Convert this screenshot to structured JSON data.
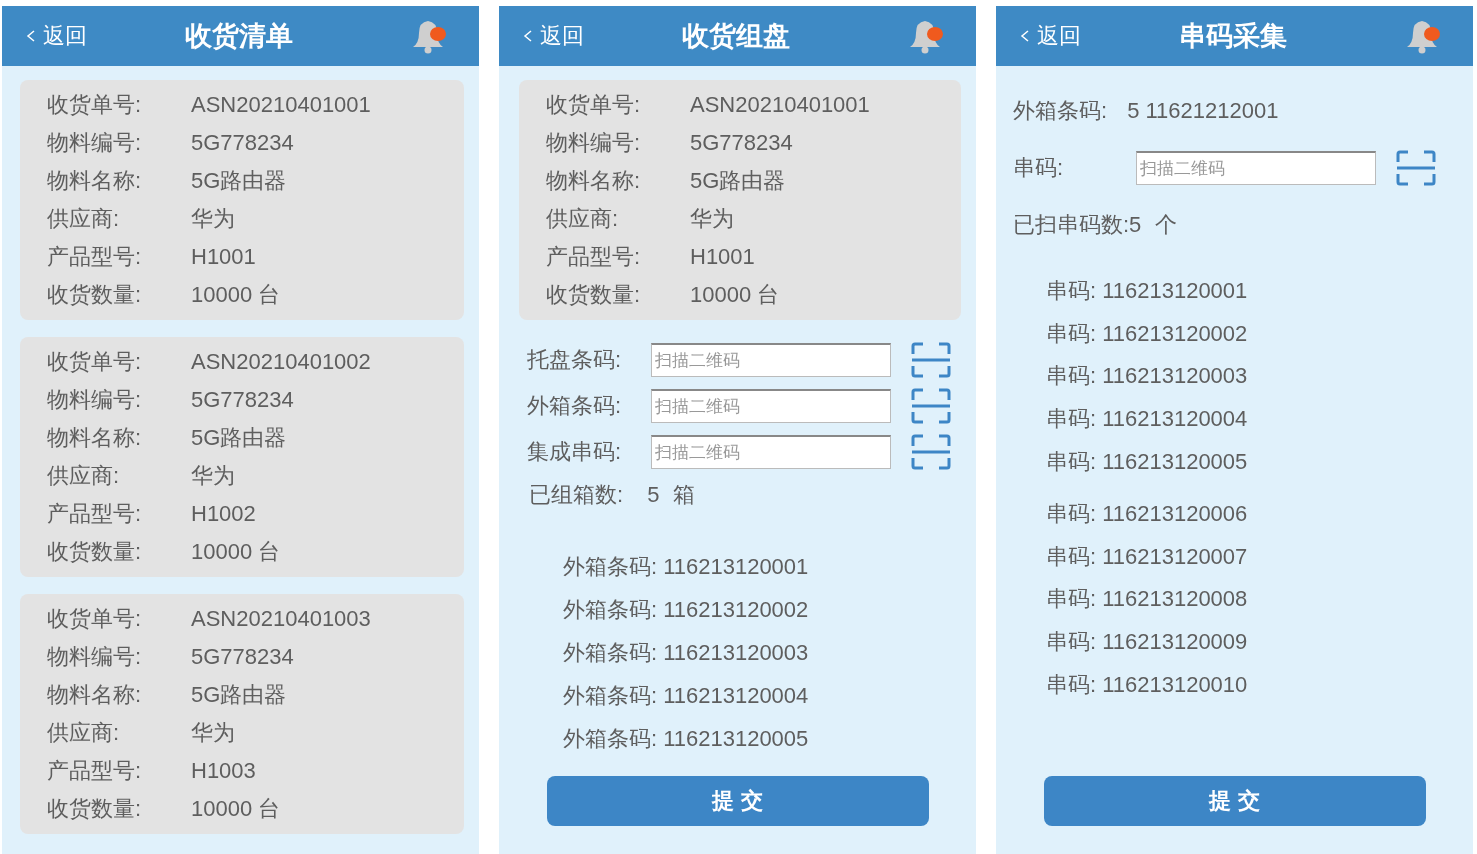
{
  "screens": [
    {
      "back": "返回",
      "title": "收货清单",
      "sections": [
        {
          "kind": "card",
          "fields": [
            {
              "label": "收货单号:",
              "value": "ASN20210401001"
            },
            {
              "label": "物料编号:",
              "value": "5G778234"
            },
            {
              "label": "物料名称:",
              "value": "5G路由器"
            },
            {
              "label": "供应商:",
              "value": "华为"
            },
            {
              "label": "产品型号:",
              "value": "H1001"
            },
            {
              "label": "收货数量:",
              "value": "10000 台"
            }
          ]
        },
        {
          "kind": "card",
          "fields": [
            {
              "label": "收货单号:",
              "value": "ASN20210401002"
            },
            {
              "label": "物料编号:",
              "value": "5G778234"
            },
            {
              "label": "物料名称:",
              "value": "5G路由器"
            },
            {
              "label": "供应商:",
              "value": "华为"
            },
            {
              "label": "产品型号:",
              "value": "H1002"
            },
            {
              "label": "收货数量:",
              "value": "10000 台"
            }
          ]
        },
        {
          "kind": "card",
          "fields": [
            {
              "label": "收货单号:",
              "value": "ASN20210401003"
            },
            {
              "label": "物料编号:",
              "value": "5G778234"
            },
            {
              "label": "物料名称:",
              "value": "5G路由器"
            },
            {
              "label": "供应商:",
              "value": "华为"
            },
            {
              "label": "产品型号:",
              "value": "H1003"
            },
            {
              "label": "收货数量:",
              "value": "10000 台"
            }
          ]
        }
      ]
    },
    {
      "back": "返回",
      "title": "收货组盘",
      "sections": [
        {
          "kind": "card",
          "fields": [
            {
              "label": "收货单号:",
              "value": "ASN20210401001"
            },
            {
              "label": "物料编号:",
              "value": "5G778234"
            },
            {
              "label": "物料名称:",
              "value": "5G路由器"
            },
            {
              "label": "供应商:",
              "value": "华为"
            },
            {
              "label": "产品型号:",
              "value": "H1001"
            },
            {
              "label": "收货数量:",
              "value": "10000 台"
            }
          ]
        },
        {
          "kind": "scan",
          "fields": [
            {
              "label": "托盘条码:",
              "placeholder": "扫描二维码"
            },
            {
              "label": "外箱条码:",
              "placeholder": "扫描二维码"
            },
            {
              "label": "集成串码:",
              "placeholder": "扫描二维码"
            }
          ]
        },
        {
          "kind": "count",
          "label": "已组箱数:",
          "value": "5",
          "unit": "箱"
        },
        {
          "kind": "codes",
          "items": [
            {
              "label": "外箱条码:",
              "value": "116213120001"
            },
            {
              "label": "外箱条码:",
              "value": "116213120002"
            },
            {
              "label": "外箱条码:",
              "value": "116213120003"
            },
            {
              "label": "外箱条码:",
              "value": "116213120004"
            },
            {
              "label": "外箱条码:",
              "value": "116213120005"
            }
          ]
        },
        {
          "kind": "submit",
          "label": "提 交"
        }
      ]
    },
    {
      "back": "返回",
      "title": "串码采集",
      "sections": [
        {
          "kind": "info",
          "label": "外箱条码:",
          "value": "5 11621212001"
        },
        {
          "kind": "scan",
          "fields": [
            {
              "label": "串码:",
              "placeholder": "扫描二维码"
            }
          ]
        },
        {
          "kind": "count",
          "label": "已扫串码数:5",
          "unit": "个"
        },
        {
          "kind": "codes",
          "items": [
            {
              "label": "串码:",
              "value": "116213120001"
            },
            {
              "label": "串码:",
              "value": "116213120002"
            },
            {
              "label": "串码:",
              "value": "116213120003"
            },
            {
              "label": "串码:",
              "value": "116213120004"
            },
            {
              "label": "串码:",
              "value": "116213120005"
            },
            {
              "label": "串码:",
              "value": "116213120006"
            },
            {
              "label": "串码:",
              "value": "116213120007"
            },
            {
              "label": "串码:",
              "value": "116213120008"
            },
            {
              "label": "串码:",
              "value": "116213120009"
            },
            {
              "label": "串码:",
              "value": "116213120010"
            }
          ]
        },
        {
          "kind": "submit",
          "label": "提 交"
        }
      ]
    }
  ]
}
